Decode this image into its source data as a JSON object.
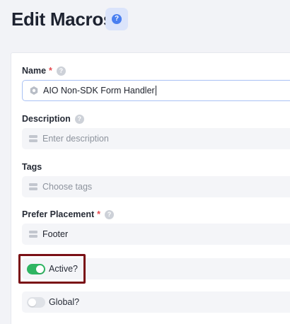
{
  "header": {
    "title": "Edit Macros",
    "help_icon": "question-circle-icon"
  },
  "form": {
    "name": {
      "label": "Name",
      "required_mark": "*",
      "value": "AIO Non-SDK Form Handler",
      "icon": "hexagon-icon"
    },
    "description": {
      "label": "Description",
      "placeholder": "Enter description",
      "icon": "list-icon"
    },
    "tags": {
      "label": "Tags",
      "placeholder": "Choose tags",
      "icon": "list-icon"
    },
    "prefer_placement": {
      "label": "Prefer Placement",
      "required_mark": "*",
      "value": "Footer",
      "icon": "list-icon"
    },
    "active": {
      "label": "Active?",
      "on": true
    },
    "global": {
      "label": "Global?",
      "on": false
    }
  },
  "colors": {
    "accent": "#4a7ff0",
    "toggle_on": "#2fb562",
    "required": "#e5484d",
    "highlight_border": "#7a1016"
  }
}
